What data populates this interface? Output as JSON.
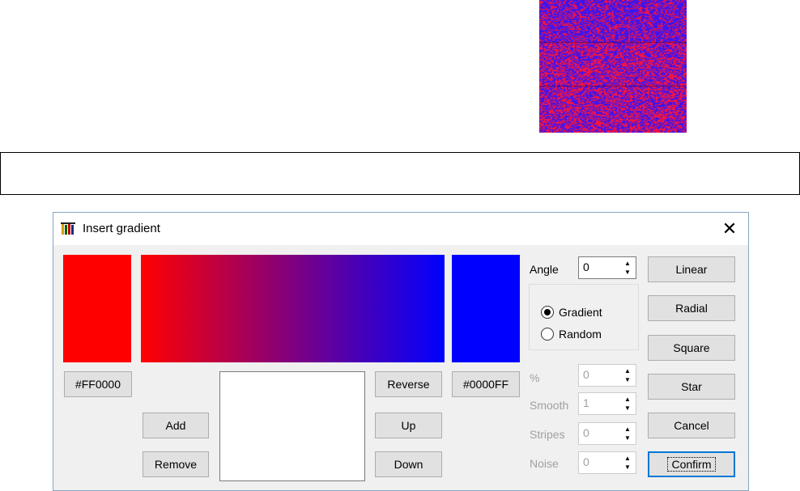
{
  "dialog": {
    "title": "Insert gradient",
    "close_glyph": "✕"
  },
  "colors": {
    "start": "#FF0000",
    "end": "#0000FF"
  },
  "start_color_label": "#FF0000",
  "end_color_label": "#0000FF",
  "stop_buttons": {
    "add": "Add",
    "remove": "Remove"
  },
  "order_buttons": {
    "reverse": "Reverse",
    "up": "Up",
    "down": "Down"
  },
  "angle": {
    "label": "Angle",
    "value": "0"
  },
  "mode": {
    "options": [
      "Gradient",
      "Random"
    ],
    "selected": "Gradient"
  },
  "params": {
    "percent": {
      "label": "%",
      "value": "0"
    },
    "smooth": {
      "label": "Smooth",
      "value": "1"
    },
    "stripes": {
      "label": "Stripes",
      "value": "0"
    },
    "noise": {
      "label": "Noise",
      "value": "0"
    }
  },
  "type_buttons": {
    "linear": "Linear",
    "radial": "Radial",
    "square": "Square",
    "star": "Star"
  },
  "actions": {
    "cancel": "Cancel",
    "confirm": "Confirm"
  },
  "icons": {
    "dialog_icon": "gradient-app-icon",
    "spin_up": "▲",
    "spin_down": "▼"
  }
}
